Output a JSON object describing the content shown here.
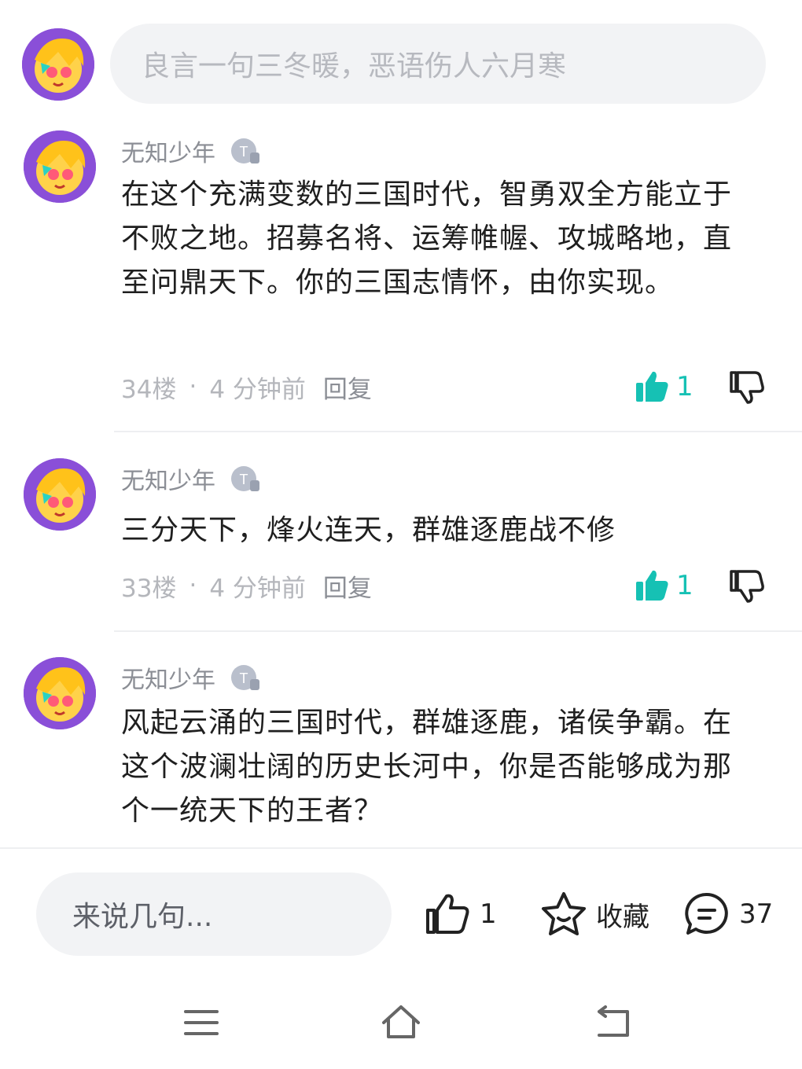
{
  "composer": {
    "placeholder": "良言一句三冬暖，恶语伤人六月寒"
  },
  "comments": [
    {
      "user": "无知少年",
      "text": "在这个充满变数的三国时代，智勇双全方能立于不败之地。招募名将、运筹帷幄、攻城略地，直至问鼎天下。你的三国志情怀，由你实现。",
      "floor": "34楼",
      "time": "4 分钟前",
      "reply": "回复",
      "likes": "1"
    },
    {
      "user": "无知少年",
      "text": "三分天下，烽火连天，群雄逐鹿战不修",
      "floor": "33楼",
      "time": "4 分钟前",
      "reply": "回复",
      "likes": "1"
    },
    {
      "user": "无知少年",
      "text": "风起云涌的三国时代，群雄逐鹿，诸侯争霸。在这个波澜壮阔的历史长河中，你是否能够成为那个一统天下的王者？"
    }
  ],
  "meta_separator": "·",
  "bottom_bar": {
    "say_placeholder": "来说几句...",
    "like_count": "1",
    "favorite_label": "收藏",
    "comment_count": "37"
  },
  "colors": {
    "accent_like": "#16c1b4",
    "muted_text": "#8b8e95",
    "input_bg": "#f2f3f5"
  }
}
